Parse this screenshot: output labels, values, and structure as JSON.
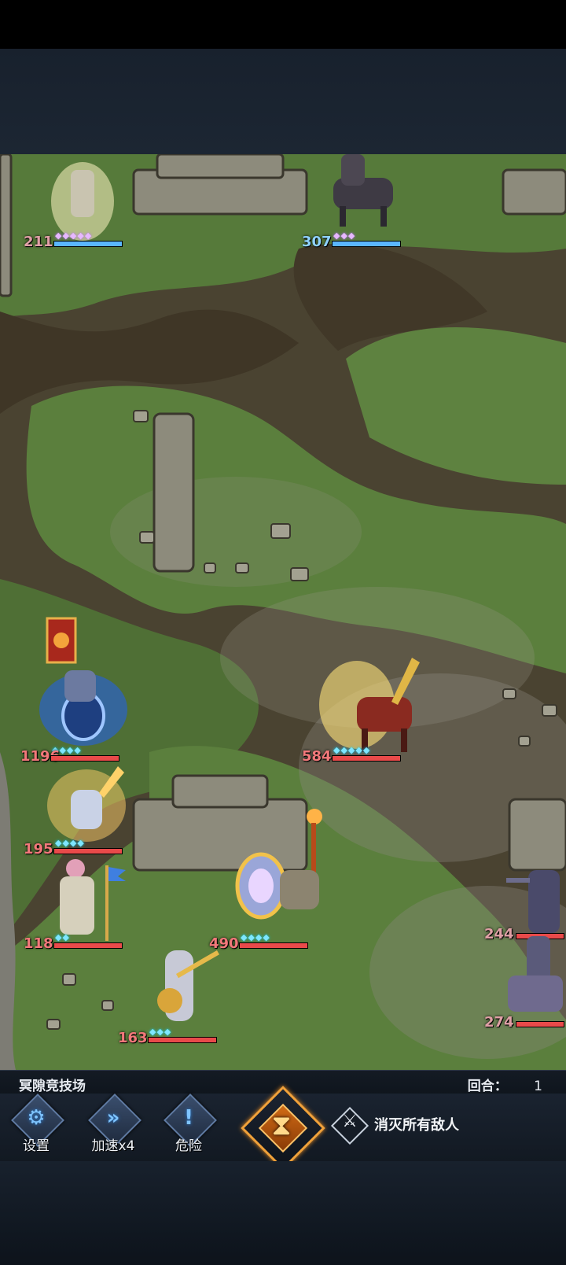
{
  "stage": {
    "name": "冥隙竞技场",
    "round_label": "回合：",
    "round_value": "1"
  },
  "toolbar": {
    "settings_label": "设置",
    "settings_icon": "gear-icon",
    "speed_label": "加速x4",
    "speed_icon": "fast-forward-icon",
    "danger_label": "危险",
    "danger_icon": "exclamation-icon",
    "hourglass_icon": "hourglass-icon",
    "objective_icon": "crossed-swords-icon",
    "objective_text": "消灭所有敌人"
  },
  "units": {
    "enemy_1": {
      "hp": "211",
      "icon": "archer-icon"
    },
    "enemy_2": {
      "hp": "307",
      "icon": "cavalry-icon"
    },
    "ally_knight": {
      "hp": "1196",
      "icon": "shield-knight-icon"
    },
    "ally_golden_cavalry": {
      "hp": "584",
      "icon": "cavalry-icon"
    },
    "ally_mage": {
      "hp": "195",
      "icon": "mage-icon"
    },
    "ally_priest": {
      "hp": "118",
      "icon": "priest-icon"
    },
    "ally_paladin": {
      "hp": "490",
      "icon": "paladin-icon"
    },
    "ally_bard": {
      "hp": "163",
      "icon": "bard-icon"
    },
    "enemy_3": {
      "hp": "244",
      "icon": "warrior-icon"
    },
    "enemy_4": {
      "hp": "274",
      "icon": "chariot-icon"
    }
  },
  "colors": {
    "ally_hp": "#e94a4a",
    "enemy_hp": "#5ab6ff",
    "accent_orange": "#f0a13a",
    "button_blue": "#5f7aa2"
  }
}
